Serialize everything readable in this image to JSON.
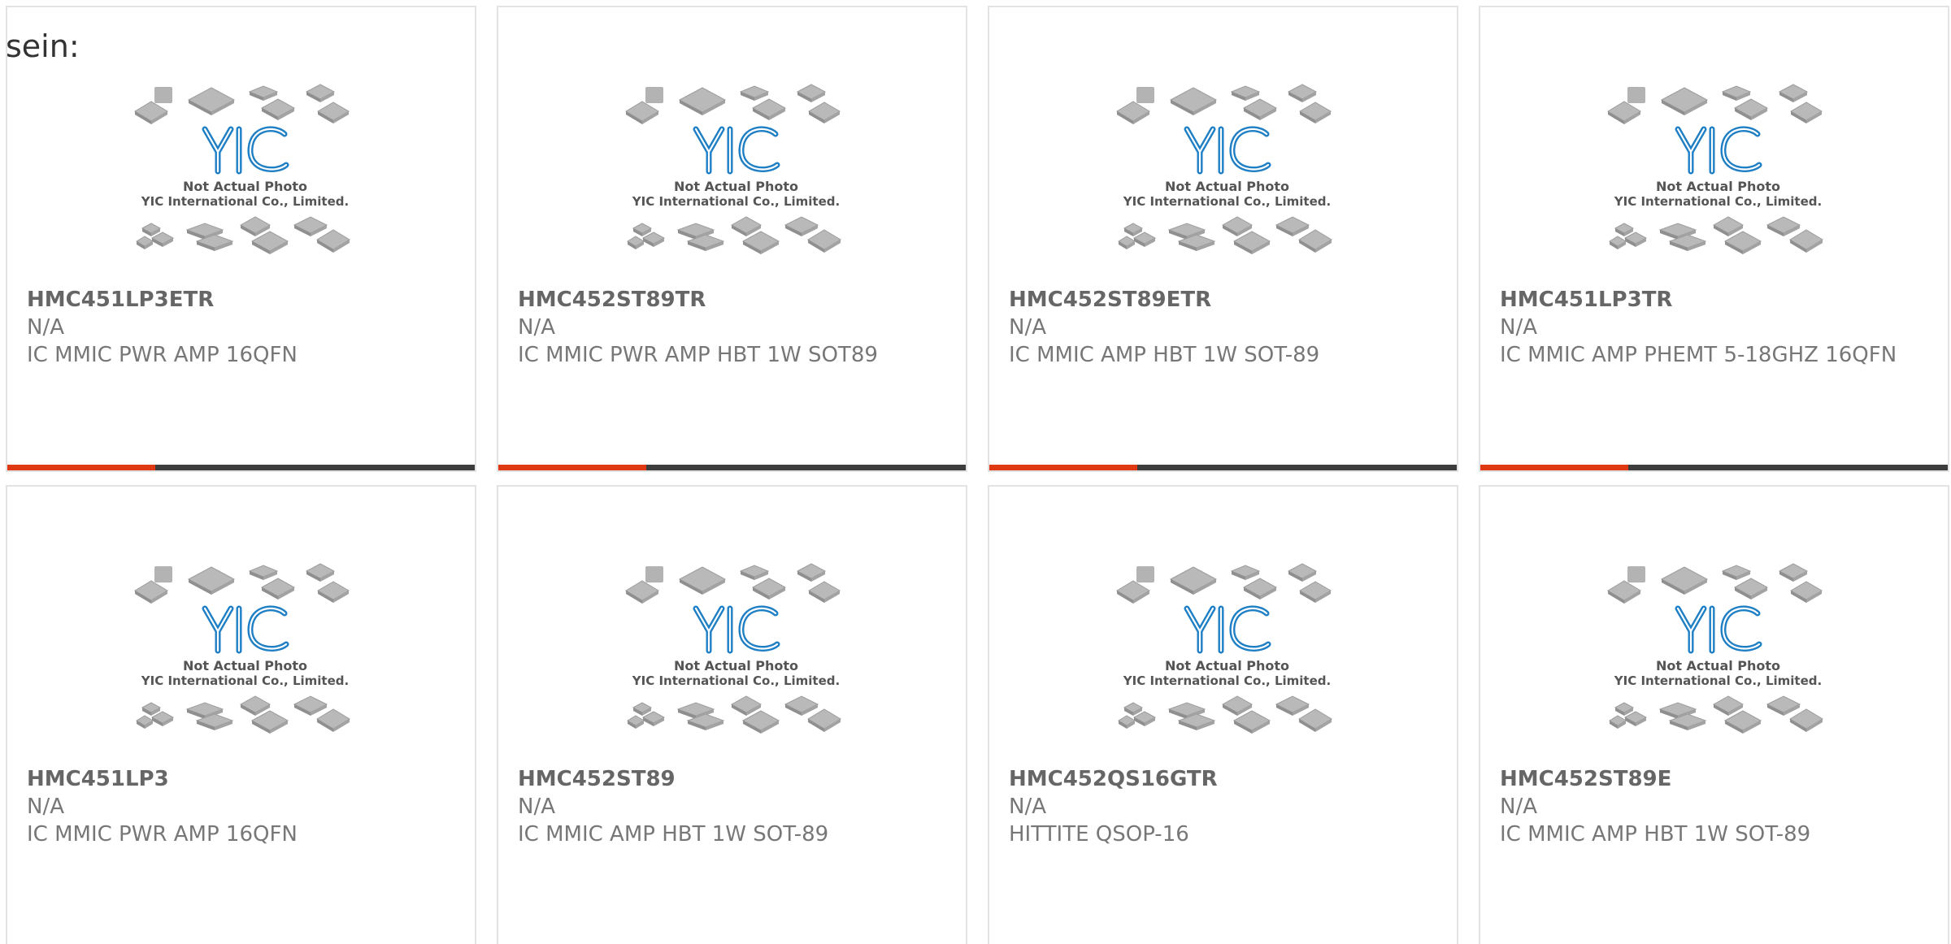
{
  "lead_text": "sein:",
  "colors": {
    "accent": "#de3912",
    "bar": "#3d3d3d",
    "logo": "#1f7fc4",
    "text": "#777777"
  },
  "placeholder": {
    "line1": "Not Actual Photo",
    "line2": "YIC International Co., Limited.",
    "logo_text": "YIC"
  },
  "products": [
    {
      "part": "HMC451LP3ETR",
      "manufacturer": "N/A",
      "description": "IC MMIC PWR AMP 16QFN"
    },
    {
      "part": "HMC452ST89TR",
      "manufacturer": "N/A",
      "description": "IC MMIC PWR AMP HBT 1W SOT89"
    },
    {
      "part": "HMC452ST89ETR",
      "manufacturer": "N/A",
      "description": "IC MMIC AMP HBT 1W SOT-89"
    },
    {
      "part": "HMC451LP3TR",
      "manufacturer": "N/A",
      "description": "IC MMIC AMP PHEMT 5-18GHZ 16QFN"
    },
    {
      "part": "HMC451LP3",
      "manufacturer": "N/A",
      "description": "IC MMIC PWR AMP 16QFN"
    },
    {
      "part": "HMC452ST89",
      "manufacturer": "N/A",
      "description": "IC MMIC AMP HBT 1W SOT-89"
    },
    {
      "part": "HMC452QS16GTR",
      "manufacturer": "N/A",
      "description": "HITTITE QSOP-16"
    },
    {
      "part": "HMC452ST89E",
      "manufacturer": "N/A",
      "description": "IC MMIC AMP HBT 1W SOT-89"
    }
  ]
}
